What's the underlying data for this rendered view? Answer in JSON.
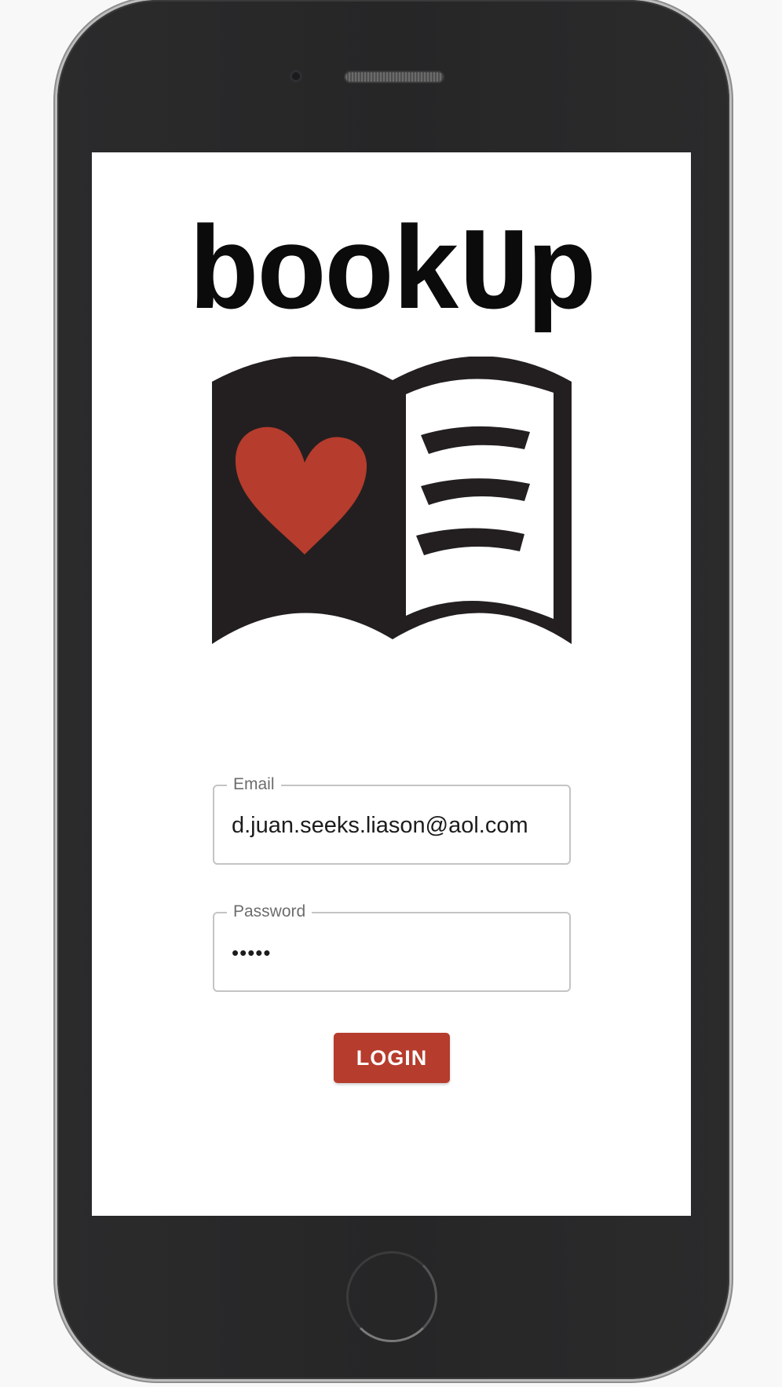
{
  "app": {
    "brand_title": "bookUp",
    "accent_color": "#b63c2d"
  },
  "logo": {
    "icon": "open-book-heart-icon",
    "heart_color": "#b63c2d",
    "ink_color": "#231f20"
  },
  "login_form": {
    "email": {
      "label": "Email",
      "value": "d.juan.seeks.liason@aol.com"
    },
    "password": {
      "label": "Password",
      "value": "•••••"
    },
    "submit_label": "LOGIN"
  },
  "device": {
    "icons": [
      "front-camera-icon",
      "speaker-grille-icon",
      "home-button-icon"
    ]
  }
}
